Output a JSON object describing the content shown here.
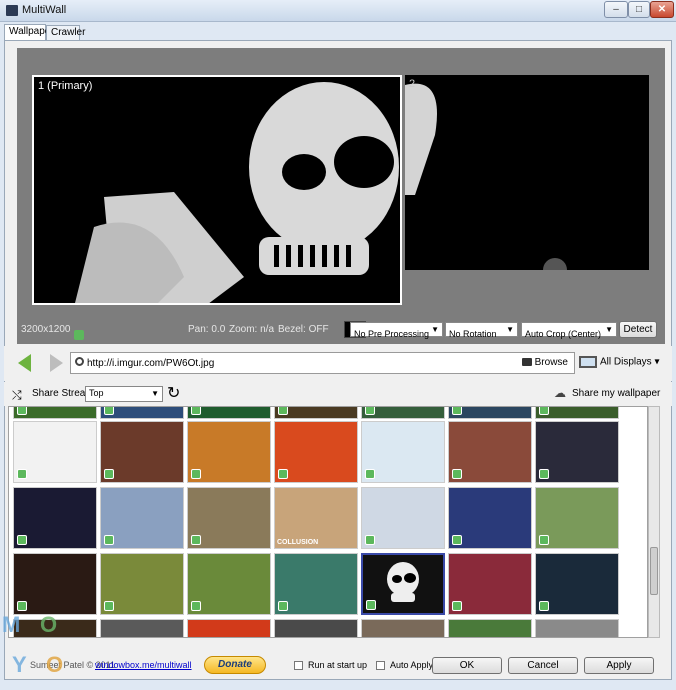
{
  "window": {
    "title": "MultiWall"
  },
  "tabs": [
    {
      "label": "Wallpaper"
    },
    {
      "label": "Crawler"
    }
  ],
  "preview": {
    "monitor1_label": "1 (Primary)",
    "monitor2_label": "2",
    "resolution": "3200x1200",
    "pan": "Pan: 0.0",
    "zoom": "Zoom: n/a",
    "bezel": "Bezel: OFF",
    "pre_processing": "No Pre Processing",
    "rotation": "No Rotation",
    "crop": "Auto Crop (Center)",
    "detect": "Detect"
  },
  "nav": {
    "url": "http://i.imgur.com/PW6Ot.jpg",
    "browse": "Browse",
    "displays": "All Displays"
  },
  "stream": {
    "share_stream": "Share Stream",
    "sort": "Top",
    "share_wallpaper": "Share my wallpaper"
  },
  "thumbnails": {
    "collusion_caption": "COLLUSION"
  },
  "footer": {
    "author": "Sumeet Patel © 2011",
    "link": "windowbox.me/multiwall",
    "donate": "Donate",
    "run_at_startup": "Run at start up",
    "auto_apply": "Auto Apply",
    "ok": "OK",
    "cancel": "Cancel",
    "apply": "Apply"
  },
  "colors": {
    "accent": "#6aa8dc",
    "preview_bg": "#7d7d7d",
    "like": "#5cb85c"
  }
}
